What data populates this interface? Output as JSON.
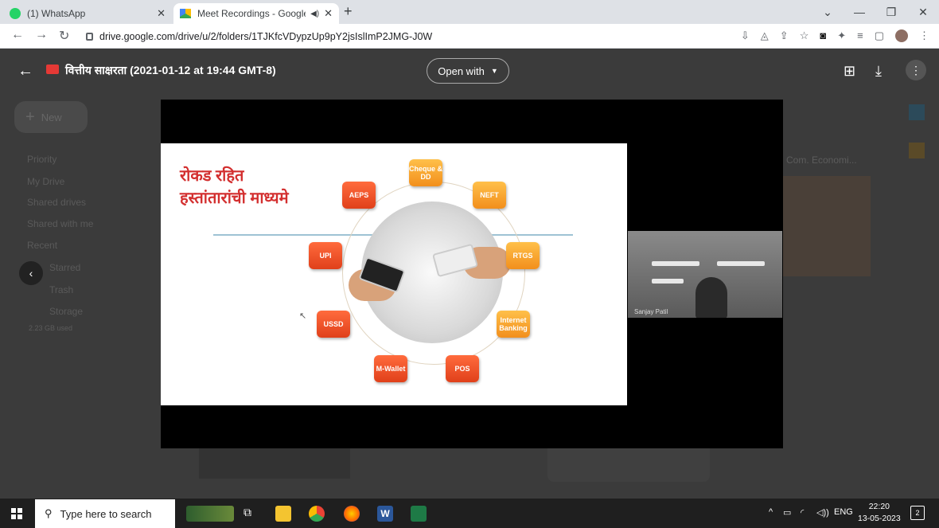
{
  "browser": {
    "tabs": [
      {
        "label": "(1) WhatsApp",
        "favicon": "whatsapp-icon",
        "favicon_color": "#25d366"
      },
      {
        "label": "Meet Recordings - Google D",
        "favicon": "google-drive-icon",
        "favicon_color": "#4285f4"
      }
    ],
    "new_tab": "+",
    "url": "drive.google.com/drive/u/2/folders/1TJKfcVDypzUp9pY2jsIslImP2JMG-J0W"
  },
  "drive_bg": {
    "new_label": "New",
    "sidebar": [
      "Priority",
      "My Drive",
      "Shared drives",
      "Shared with me",
      "Recent",
      "Starred",
      "Trash",
      "Storage"
    ],
    "storage_used": "2.23 GB used",
    "right_label": "Com. Economi..."
  },
  "viewer": {
    "file_title": "वित्तीय साक्षरता (2021-01-12 at 19:44 GMT-8)",
    "open_with": "Open with"
  },
  "slide": {
    "title_line1": "रोकड रहित",
    "title_line2": "हस्तांतारांची माध्यमे",
    "nodes": [
      "Cheque & DD",
      "NEFT",
      "RTGS",
      "Internet Banking",
      "POS",
      "M-Wallet",
      "USSD",
      "UPI",
      "AEPS"
    ]
  },
  "camera": {
    "name": "Sanjay Patil"
  },
  "taskbar": {
    "search_placeholder": "Type here to search",
    "language": "ENG",
    "time": "22:20",
    "date": "13-05-2023",
    "notifications": "2"
  },
  "colors": {
    "accent_red": "#e0401a",
    "accent_orange": "#f28f1c",
    "slide_title": "#d32f2f"
  }
}
